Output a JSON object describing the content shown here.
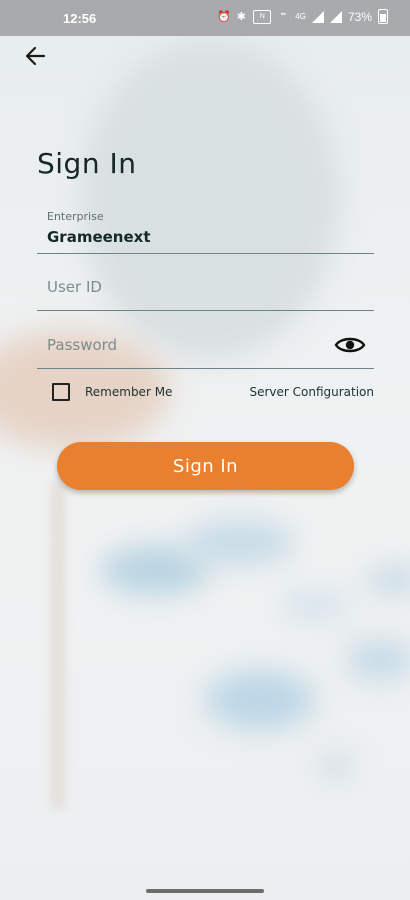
{
  "status_bar": {
    "time": "12:56",
    "battery_text": "73%",
    "network_label": "4G",
    "icons": [
      "alarm-icon",
      "bluetooth-icon",
      "nfc-icon",
      "data-speed-icon",
      "signal-icon",
      "signal-icon",
      "battery-icon"
    ]
  },
  "header": {
    "back_icon": "arrow-left-icon"
  },
  "page": {
    "title": "Sign In"
  },
  "form": {
    "enterprise": {
      "label": "Enterprise",
      "value": "Grameenext"
    },
    "user_id": {
      "placeholder": "User ID",
      "value": ""
    },
    "password": {
      "placeholder": "Password",
      "value": "",
      "toggle_icon": "eye-icon"
    },
    "remember_me": {
      "label": "Remember Me",
      "checked": false
    },
    "server_config": {
      "label": "Server Configuration"
    },
    "submit": {
      "label": "Sign In"
    }
  },
  "colors": {
    "accent": "#e8802f",
    "field_underline": "#6d8588",
    "status_bar": "#a8aaab"
  }
}
